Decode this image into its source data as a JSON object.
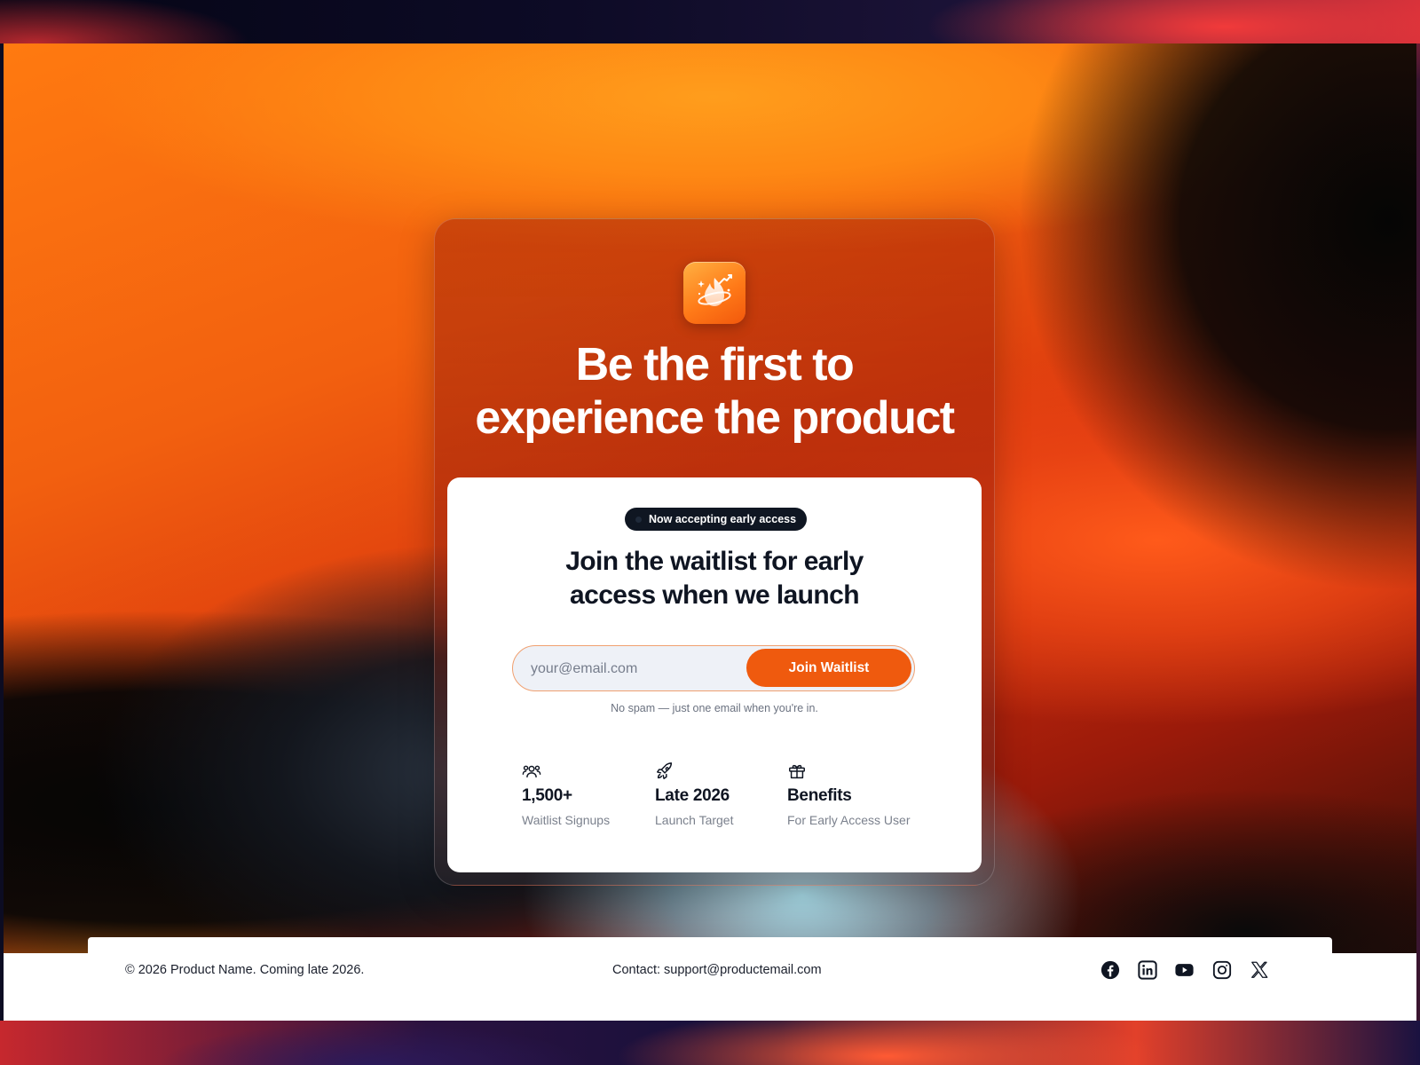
{
  "hero": {
    "headline_line1": "Be the first to",
    "headline_line2": "experience the product"
  },
  "waitlist": {
    "badge": "Now accepting early access",
    "title_line1": "Join the waitlist for early",
    "title_line2": "access when we launch",
    "email_placeholder": "your@email.com",
    "email_value": "",
    "button_label": "Join Waitlist",
    "note": "No spam — just one email when you're in."
  },
  "stats": [
    {
      "icon": "users-icon",
      "value": "1,500+",
      "label": "Waitlist Signups"
    },
    {
      "icon": "rocket-icon",
      "value": "Late 2026",
      "label": "Launch Target"
    },
    {
      "icon": "gift-icon",
      "value": "Benefits",
      "label": "For Early Access User"
    }
  ],
  "footer": {
    "copyright": "© 2026 Product Name. Coming late 2026.",
    "contact": "Contact: support@productemail.com",
    "socials": [
      "facebook-icon",
      "linkedin-icon",
      "youtube-icon",
      "instagram-icon",
      "x-icon"
    ]
  },
  "colors": {
    "accent": "#ef5a0e",
    "dark": "#0f1522",
    "input_border": "#f0a070"
  }
}
